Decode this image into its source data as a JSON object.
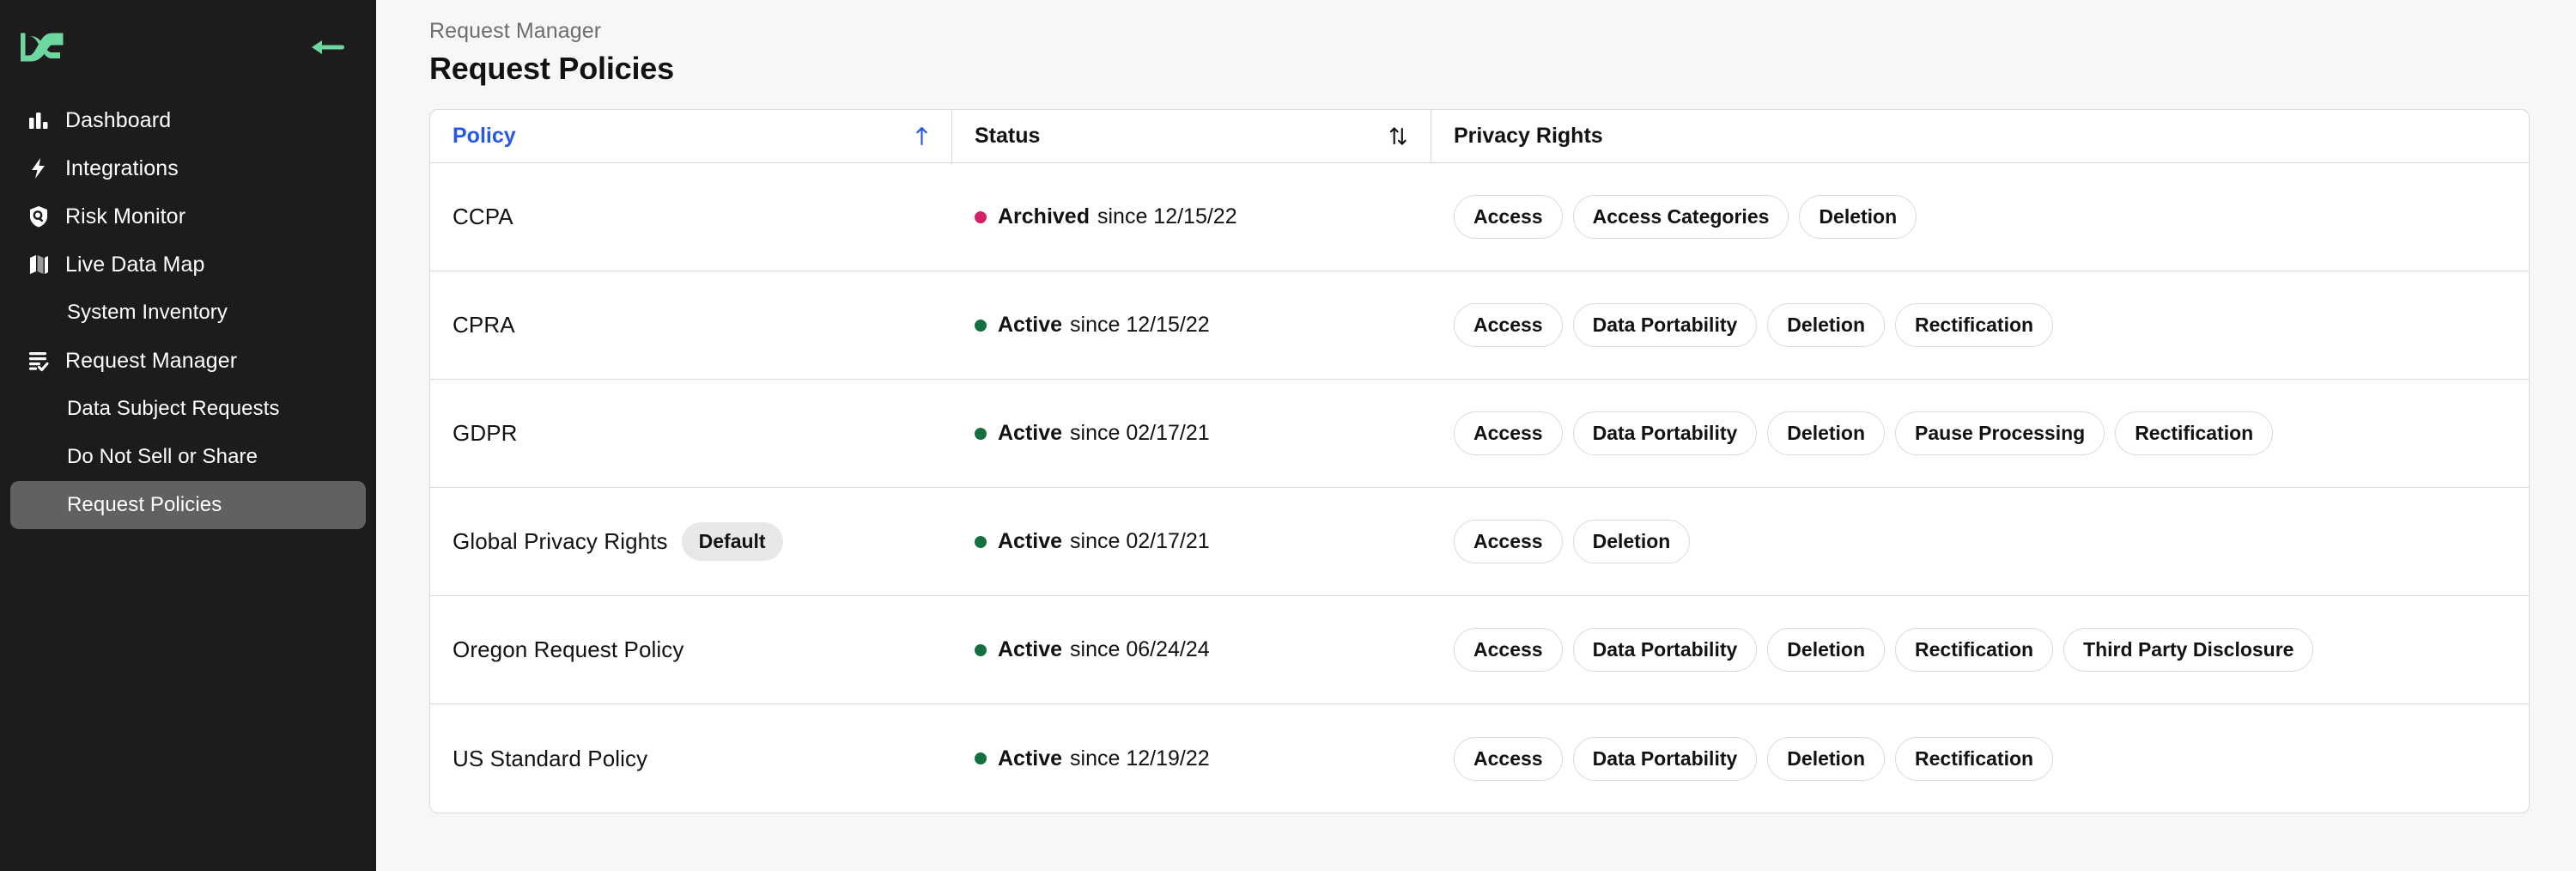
{
  "brand": {
    "logo_icon": "datagrail-logo-icon",
    "logo_color": "#6ed79f",
    "collapse_icon": "arrow-left-icon",
    "collapse_color": "#6ed79f"
  },
  "sidebar": {
    "items": [
      {
        "label": "Dashboard",
        "icon": "bar-chart-icon",
        "sub": false,
        "active": false
      },
      {
        "label": "Integrations",
        "icon": "lightning-bolt-icon",
        "sub": false,
        "active": false
      },
      {
        "label": "Risk Monitor",
        "icon": "shield-search-icon",
        "sub": false,
        "active": false
      },
      {
        "label": "Live Data Map",
        "icon": "map-icon",
        "sub": false,
        "active": false
      },
      {
        "label": "System Inventory",
        "icon": "",
        "sub": true,
        "active": false
      },
      {
        "label": "Request Manager",
        "icon": "list-check-icon",
        "sub": false,
        "active": false
      },
      {
        "label": "Data Subject Requests",
        "icon": "",
        "sub": true,
        "active": false
      },
      {
        "label": "Do Not Sell or Share",
        "icon": "",
        "sub": true,
        "active": false
      },
      {
        "label": "Request Policies",
        "icon": "",
        "sub": true,
        "active": true
      }
    ],
    "active_bg": "#616161"
  },
  "header": {
    "breadcrumb": "Request Manager",
    "title": "Request Policies"
  },
  "table": {
    "columns": [
      {
        "label": "Policy",
        "sort_icon": "arrow-up-icon",
        "sorted": true,
        "color": "#2558e6"
      },
      {
        "label": "Status",
        "sort_icon": "sort-updown-icon",
        "sorted": false,
        "color": "#121212"
      },
      {
        "label": "Privacy Rights",
        "sort_icon": "",
        "sorted": false,
        "color": "#121212"
      }
    ],
    "status_colors": {
      "Active": "#15703f",
      "Archived": "#d61f69"
    },
    "since_word": "since",
    "rows": [
      {
        "policy": "CCPA",
        "default_badge": null,
        "status": "Archived",
        "since": "12/15/22",
        "rights": [
          "Access",
          "Access Categories",
          "Deletion"
        ]
      },
      {
        "policy": "CPRA",
        "default_badge": null,
        "status": "Active",
        "since": "12/15/22",
        "rights": [
          "Access",
          "Data Portability",
          "Deletion",
          "Rectification"
        ]
      },
      {
        "policy": "GDPR",
        "default_badge": null,
        "status": "Active",
        "since": "02/17/21",
        "rights": [
          "Access",
          "Data Portability",
          "Deletion",
          "Pause Processing",
          "Rectification"
        ]
      },
      {
        "policy": "Global Privacy Rights",
        "default_badge": "Default",
        "status": "Active",
        "since": "02/17/21",
        "rights": [
          "Access",
          "Deletion"
        ]
      },
      {
        "policy": "Oregon Request Policy",
        "default_badge": null,
        "status": "Active",
        "since": "06/24/24",
        "rights": [
          "Access",
          "Data Portability",
          "Deletion",
          "Rectification",
          "Third Party Disclosure"
        ]
      },
      {
        "policy": "US Standard Policy",
        "default_badge": null,
        "status": "Active",
        "since": "12/19/22",
        "rights": [
          "Access",
          "Data Portability",
          "Deletion",
          "Rectification"
        ]
      }
    ]
  }
}
